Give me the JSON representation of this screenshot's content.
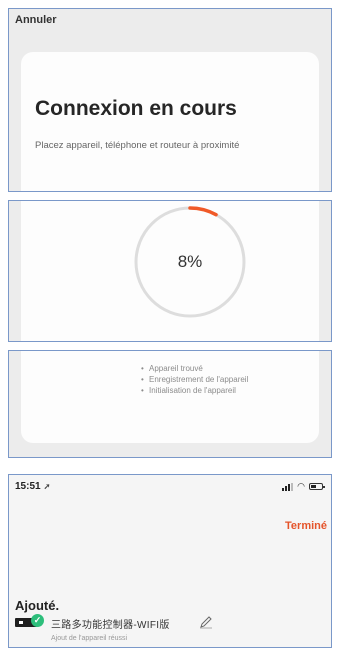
{
  "connect": {
    "cancel_label": "Annuler",
    "title": "Connexion en cours",
    "subtitle": "Placez appareil, téléphone et routeur à proximité",
    "progress": {
      "value": 8,
      "label": "8%"
    },
    "steps": [
      "Appareil trouvé",
      "Enregistrement de l'appareil",
      "Initialisation de l'appareil"
    ]
  },
  "result": {
    "time": "15:51",
    "done_label": "Terminé",
    "added_title": "Ajouté.",
    "device": {
      "name": "三路多功能控制器-WIFI版",
      "subtitle": "Ajout de l'appareil réussi"
    }
  },
  "colors": {
    "accent": "#f05a28",
    "success": "#2dbe7b",
    "ring": "#dddddd"
  },
  "icons": [
    "location-arrow-icon",
    "signal-icon",
    "wifi-icon",
    "battery-icon",
    "check-icon",
    "edit-pencil-icon"
  ]
}
